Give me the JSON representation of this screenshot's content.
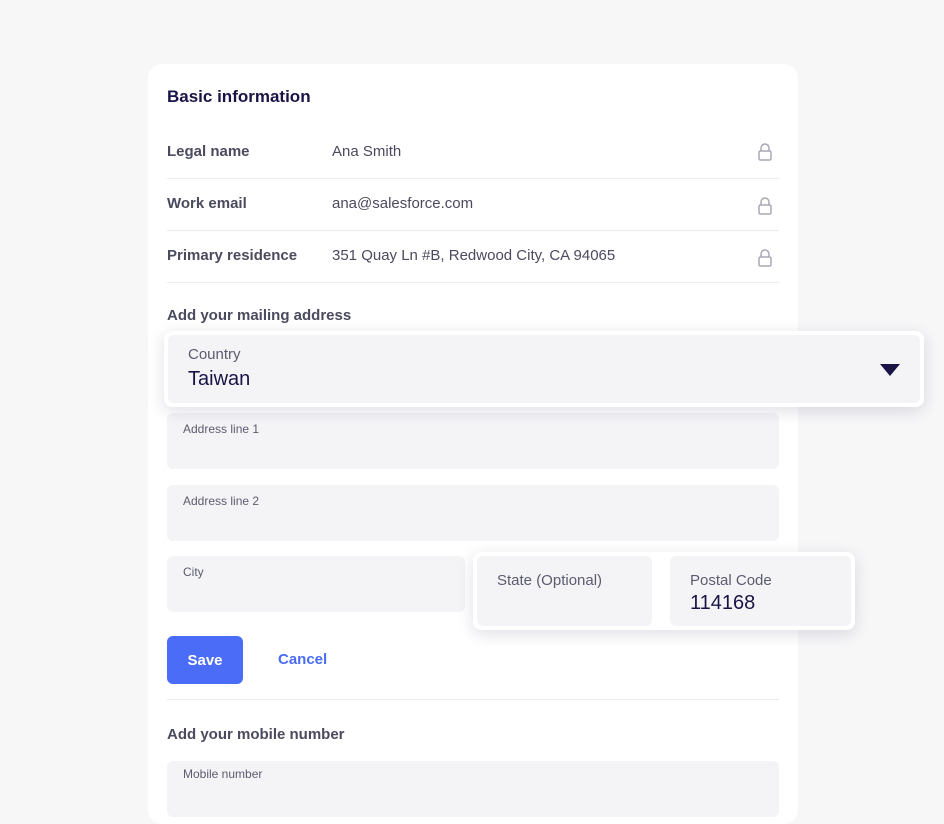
{
  "basic_info": {
    "title": "Basic information",
    "rows": [
      {
        "label": "Legal name",
        "value": "Ana Smith",
        "icon": "lock-icon"
      },
      {
        "label": "Work email",
        "value": "ana@salesforce.com",
        "icon": "lock-icon"
      },
      {
        "label": "Primary residence",
        "value": "351 Quay Ln #B, Redwood City, CA 94065",
        "icon": "lock-icon"
      }
    ]
  },
  "mailing": {
    "heading": "Add your mailing address",
    "country": {
      "label": "Country",
      "value": "Taiwan",
      "icon": "caret-down-icon"
    },
    "address1": {
      "label": "Address line 1",
      "value": ""
    },
    "address2": {
      "label": "Address line 2",
      "value": ""
    },
    "city": {
      "label": "City",
      "value": ""
    },
    "state": {
      "label": "State (Optional)",
      "value": ""
    },
    "postal": {
      "label": "Postal Code",
      "value": "114168"
    }
  },
  "actions": {
    "save_label": "Save",
    "cancel_label": "Cancel"
  },
  "mobile": {
    "heading": "Add your mobile number",
    "field": {
      "label": "Mobile number",
      "value": ""
    }
  },
  "colors": {
    "accent": "#4a6cf7",
    "heading": "#1a1446",
    "muted_text": "#4b4a5e",
    "field_bg": "#f4f4f7",
    "page_bg": "#f7f7f8"
  }
}
